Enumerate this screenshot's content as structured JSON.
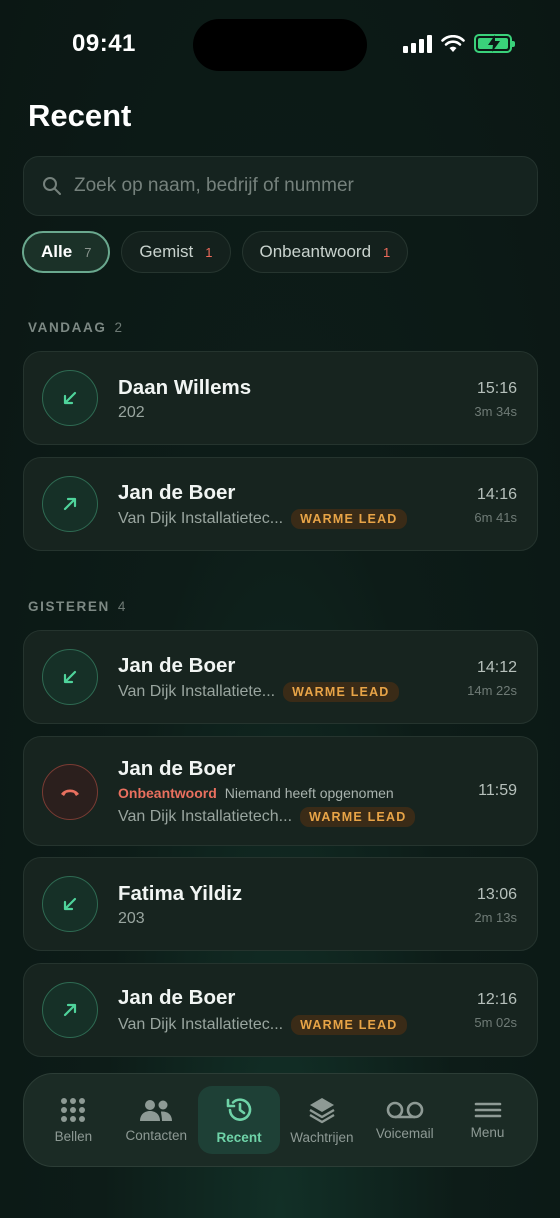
{
  "status": {
    "time": "09:41"
  },
  "header": {
    "title": "Recent"
  },
  "search": {
    "placeholder": "Zoek op naam, bedrijf of nummer"
  },
  "filters": [
    {
      "label": "Alle",
      "count": "7"
    },
    {
      "label": "Gemist",
      "count": "1"
    },
    {
      "label": "Onbeantwoord",
      "count": "1"
    }
  ],
  "sections": {
    "today": {
      "label": "VANDAAG",
      "count": "2"
    },
    "yesterday": {
      "label": "GISTEREN",
      "count": "4"
    }
  },
  "calls": [
    {
      "name": "Daan Willems",
      "sub": "202",
      "time": "15:16",
      "duration": "3m 34s",
      "direction": "incoming"
    },
    {
      "name": "Jan de Boer",
      "sub": "Van Dijk Installatietec...",
      "tag": "WARME LEAD",
      "time": "14:16",
      "duration": "6m 41s",
      "direction": "outgoing"
    },
    {
      "name": "Jan de Boer",
      "sub": "Van Dijk Installatiete...",
      "tag": "WARME LEAD",
      "time": "14:12",
      "duration": "14m 22s",
      "direction": "incoming"
    },
    {
      "name": "Jan de Boer",
      "status": "Onbeantwoord",
      "status_note": "Niemand heeft opgenomen",
      "sub": "Van Dijk Installatietech...",
      "tag": "WARME LEAD",
      "time": "11:59",
      "direction": "missed"
    },
    {
      "name": "Fatima Yildiz",
      "sub": "203",
      "time": "13:06",
      "duration": "2m 13s",
      "direction": "incoming"
    },
    {
      "name": "Jan de Boer",
      "sub": "Van Dijk Installatietec...",
      "tag": "WARME LEAD",
      "time": "12:16",
      "duration": "5m 02s",
      "direction": "outgoing"
    }
  ],
  "tabs": [
    {
      "label": "Bellen",
      "icon": "keypad-icon"
    },
    {
      "label": "Contacten",
      "icon": "contacts-icon"
    },
    {
      "label": "Recent",
      "icon": "history-icon",
      "active": true
    },
    {
      "label": "Wachtrijen",
      "icon": "layers-icon"
    },
    {
      "label": "Voicemail",
      "icon": "voicemail-icon"
    },
    {
      "label": "Menu",
      "icon": "menu-icon"
    }
  ],
  "colors": {
    "accent": "#6fd3a8",
    "tag_text": "#e8a447",
    "missed": "#e9705f"
  }
}
